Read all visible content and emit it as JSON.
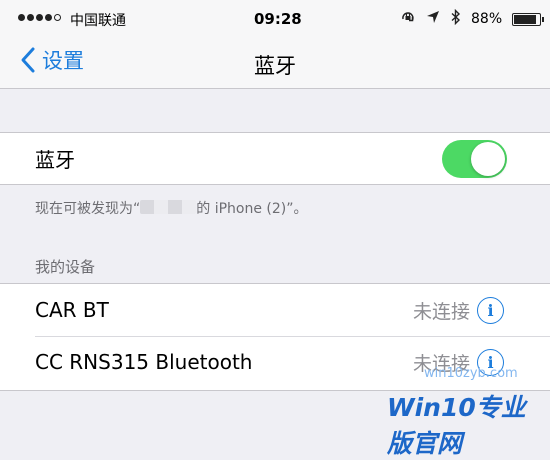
{
  "status_bar": {
    "carrier": "中国联通",
    "time": "09:28",
    "lock_icon": "orientation-lock-icon",
    "location_icon": "location-arrow-icon",
    "bluetooth_icon": "bluetooth-icon",
    "battery": "88%",
    "battery_level": 0.88
  },
  "nav": {
    "back_label": "设置",
    "title": "蓝牙"
  },
  "bluetooth": {
    "label": "蓝牙",
    "enabled": true,
    "discoverable_prefix": "现在可被发现为“",
    "discoverable_suffix": "的 iPhone (2)”。"
  },
  "devices": {
    "header": "我的设备",
    "items": [
      {
        "name": "CAR BT",
        "status": "未连接"
      },
      {
        "name": "CC RNS315 Bluetooth",
        "status": "未连接"
      }
    ]
  },
  "watermark": {
    "main": "Win10专业版官网",
    "sub": "win10zyb.com"
  },
  "colors": {
    "accent": "#1d7ddc",
    "toggle_on": "#4cd964",
    "background": "#efeff4"
  }
}
